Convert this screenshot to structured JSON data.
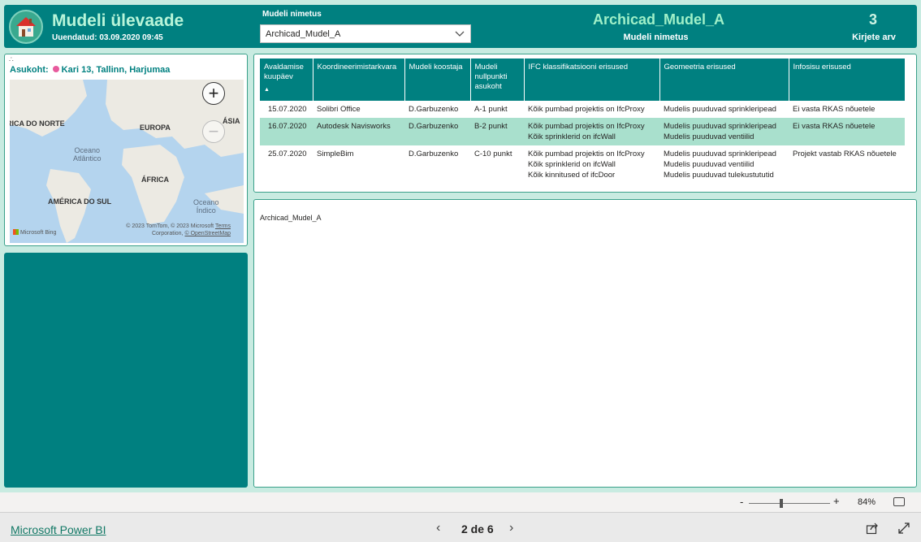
{
  "header": {
    "title": "Mudeli ülevaade",
    "updated": "Uuendatud: 03.09.2020 09:45",
    "slicer_label": "Mudeli nimetus",
    "slicer_value": "Archicad_Mudel_A",
    "model_card_value": "Archicad_Mudel_A",
    "model_card_label": "Mudeli nimetus",
    "count_value": "3",
    "count_label": "Kirjete arv"
  },
  "map": {
    "legend_label": "Asukoht:",
    "legend_value": "Kari 13, Tallinn, Harjumaa",
    "legend_color": "#e85a9d",
    "labels": [
      "RICA DO NORTE",
      "EUROPA",
      "ÁSIA",
      "ÁFRICA",
      "AMÉRICA DO SUL"
    ],
    "ocean_atlantic": [
      "Oceano",
      "Atlântico"
    ],
    "ocean_indian": [
      "Oceano",
      "Índico"
    ],
    "copyright": "© 2023 TomTom, © 2023 Microsoft",
    "terms": "Terms",
    "corporation": "Corporation,",
    "osm": "© OpenStreetMap",
    "bing": "Microsoft Bing"
  },
  "table": {
    "columns": [
      "Avaldamise kuupäev",
      "Koordineerimistarkvara",
      "Mudeli koostaja",
      "Mudeli nullpunkti asukoht",
      "IFC klassifikatsiooni erisused",
      "Geomeetria erisused",
      "Infosisu erisused"
    ],
    "sort_indicator": "▲",
    "rows": [
      {
        "date": "15.07.2020",
        "software": "Solibri Office",
        "author": "D.Garbuzenko",
        "origin": "A-1 punkt",
        "ifc": [
          "Kõik pumbad projektis on IfcProxy"
        ],
        "geometry": [
          "Mudelis puuduvad sprinkleripead"
        ],
        "info": [
          "Ei vasta RKAS nõuetele"
        ]
      },
      {
        "date": "16.07.2020",
        "software": "Autodesk Navisworks",
        "author": "D.Garbuzenko",
        "origin": "B-2 punkt",
        "ifc": [
          "Kõik pumbad projektis on IfcProxy",
          "Kõik sprinklerid on ifcWall"
        ],
        "geometry": [
          "Mudelis puuduvad sprinkleripead",
          "Mudelis puuduvad ventiilid"
        ],
        "info": [
          "Ei vasta RKAS nõuetele"
        ]
      },
      {
        "date": "25.07.2020",
        "software": "SimpleBim",
        "author": "D.Garbuzenko",
        "origin": "C-10 punkt",
        "ifc": [
          "Kõik pumbad projektis on IfcProxy",
          "Kõik sprinklerid on ifcWall",
          "Kõik kinnitused of ifcDoor"
        ],
        "geometry": [
          "Mudelis puuduvad sprinkleripead",
          "Mudelis puuduvad ventiilid",
          "Mudelis puuduvad tulekustututid"
        ],
        "info": [
          "Projekt vastab RKAS nõuetele"
        ]
      }
    ]
  },
  "text_panel": {
    "value": "Archicad_Mudel_A"
  },
  "zoombar": {
    "minus": "-",
    "plus": "+",
    "percent": "84%",
    "level": 0.4
  },
  "footer": {
    "brand": "Microsoft Power BI",
    "page": "2 de 6"
  },
  "colors": {
    "accent": "#008080",
    "canvas": "#c8ebe1",
    "row_highlight": "#a9e0cd"
  }
}
